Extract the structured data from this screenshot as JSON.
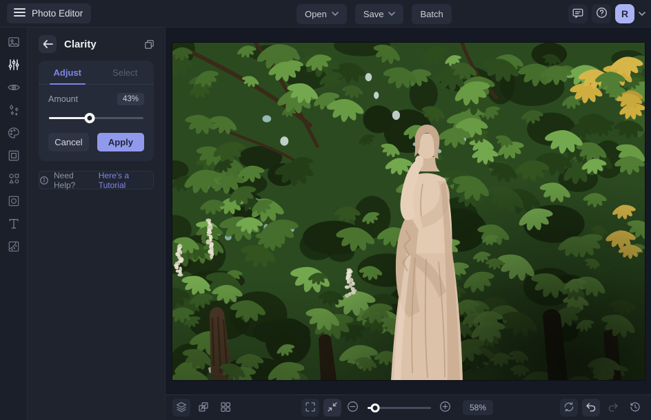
{
  "app": {
    "title": "Photo Editor"
  },
  "topbar": {
    "open_label": "Open",
    "save_label": "Save",
    "batch_label": "Batch",
    "avatar_initial": "R",
    "icons": [
      "hamburger-icon",
      "comment-icon",
      "help-icon",
      "chevron-down-icon"
    ]
  },
  "sidebar": {
    "tools": [
      "photo",
      "adjustments",
      "touchup-eye",
      "effects",
      "artsy-palette",
      "frames",
      "graphics-shapes",
      "overlays",
      "text",
      "textures"
    ],
    "active_tool": "adjustments"
  },
  "panel": {
    "title": "Clarity",
    "tabs": [
      {
        "label": "Adjust",
        "active": true
      },
      {
        "label": "Select",
        "active": false
      }
    ],
    "amount_label": "Amount",
    "amount_value": "43%",
    "amount_percent": 43,
    "cancel_label": "Cancel",
    "apply_label": "Apply",
    "help_text": "Need Help?",
    "help_link": "Here's a Tutorial"
  },
  "canvas": {
    "image_description": "Marble statue of a woman in draped robes, hand raised to her cheek, standing before a dense wall of green chestnut foliage with scattered yellow leaves, white blossom spikes and dark tree trunks"
  },
  "bottombar": {
    "zoom_value": "58%",
    "zoom_percent": 58,
    "zoom_slider_percent": 12,
    "icons": [
      "layers-icon",
      "resize-icon",
      "grid-icon",
      "fullscreen-icon",
      "fit-screen-icon",
      "zoom-out-icon",
      "zoom-in-icon",
      "reset-icon",
      "undo-icon",
      "redo-icon",
      "history-icon"
    ]
  },
  "colors": {
    "accent": "#7f87e8",
    "apply_bg": "#9199ec",
    "avatar_bg": "#abb2f4",
    "topbar_bg": "#1c212c",
    "panel_bg": "#1e232e",
    "card_bg": "#252b38",
    "canvas_bg": "#151924"
  }
}
